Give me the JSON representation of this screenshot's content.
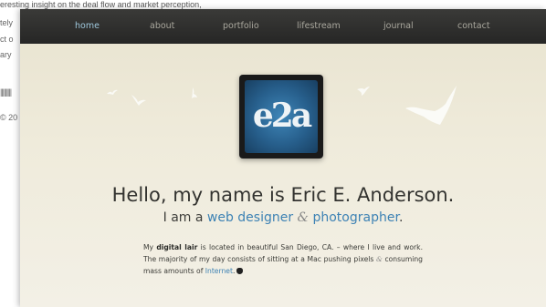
{
  "background": {
    "top_text": "eresting insight on the deal flow and market perception,",
    "left_fragments": [
      "tely",
      "ct o",
      "ary",
      "|||||||||",
      "© 20"
    ]
  },
  "nav": {
    "items": [
      {
        "label": "home",
        "active": true
      },
      {
        "label": "about",
        "active": false
      },
      {
        "label": "portfolio",
        "active": false
      },
      {
        "label": "lifestream",
        "active": false
      },
      {
        "label": "journal",
        "active": false
      },
      {
        "label": "contact",
        "active": false
      }
    ]
  },
  "logo": {
    "text": "e2a"
  },
  "hero": {
    "title": "Hello, my name is Eric E. Anderson.",
    "subtitle_prefix": "I am a ",
    "subtitle_link1": "web designer",
    "subtitle_amp": " & ",
    "subtitle_link2": "photographer",
    "subtitle_suffix": "."
  },
  "intro": {
    "part1": "My ",
    "bold": "digital lair",
    "part2": " is located in beautiful San Diego, CA. – where I live and work. The majority of my day consists of sitting at a Mac pushing pixels ",
    "amp": "&",
    "part3": " consuming mass amounts of ",
    "link": "Internet",
    "part4": "."
  },
  "colors": {
    "accent": "#3d82b4",
    "nav_bg": "#2e2e2c",
    "page_bg": "#ece8d6"
  },
  "icons": [
    "bird-icon",
    "apple-icon"
  ]
}
